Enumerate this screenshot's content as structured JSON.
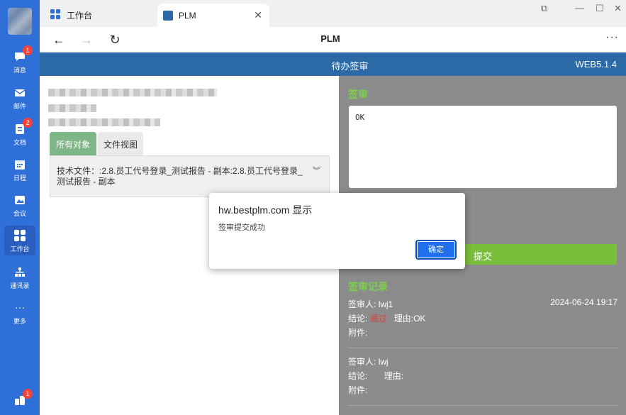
{
  "rail": {
    "items": [
      {
        "label": "消息",
        "badge": "1"
      },
      {
        "label": "邮件",
        "badge": ""
      },
      {
        "label": "文档",
        "badge": "2"
      },
      {
        "label": "日程",
        "badge": ""
      },
      {
        "label": "会议",
        "badge": ""
      },
      {
        "label": "工作台",
        "badge": ""
      },
      {
        "label": "通讯录",
        "badge": ""
      },
      {
        "label": "更多",
        "badge": ""
      }
    ],
    "bottom_badge": "1"
  },
  "browser": {
    "tabs": [
      {
        "label": "工作台",
        "icon": "grid-icon"
      },
      {
        "label": "PLM",
        "icon": "plm-logo-icon",
        "close": "✕"
      }
    ],
    "page_title": "PLM",
    "more": "···"
  },
  "app": {
    "title": "待办签审",
    "version": "WEB5.1.4"
  },
  "left": {
    "tab_all": "所有对象",
    "tab_file": "文件视图",
    "file_text": "技术文件：:2.8.员工代号登录_测试报告 - 副本:2.8.员工代号登录_测试报告 - 副本"
  },
  "right": {
    "sign_title": "签审",
    "comment": "OK",
    "submit": "提交",
    "records_title": "签审记录",
    "records": [
      {
        "signer_label": "签审人:",
        "signer": "lwj1",
        "date": "2024-06-24 19:17",
        "result_label": "结论:",
        "result": "通过",
        "reason_label": "理由:",
        "reason": "OK",
        "attach_label": "附件:"
      },
      {
        "signer_label": "签审人:",
        "signer": "lwj",
        "date": "",
        "result_label": "结论:",
        "result": "",
        "reason_label": "理由:",
        "reason": "",
        "attach_label": "附件:"
      }
    ]
  },
  "dialog": {
    "title": "hw.bestplm.com 显示",
    "message": "签审提交成功",
    "ok": "确定"
  }
}
